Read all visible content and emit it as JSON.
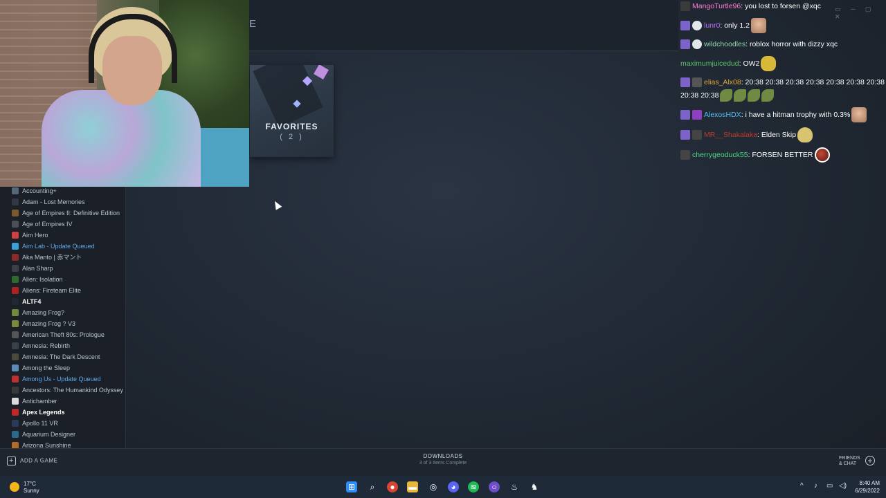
{
  "top_strip": {
    "partial_text": "E"
  },
  "favorites": {
    "title": "FAVORITES",
    "count": "( 2 )"
  },
  "sidebar": {
    "games": [
      {
        "name": "Accounting+",
        "status": "",
        "color": "#556677",
        "style": "normal"
      },
      {
        "name": "Adam - Lost Memories",
        "status": "",
        "color": "#333842",
        "style": "normal"
      },
      {
        "name": "Age of Empires II: Definitive Edition",
        "status": "",
        "color": "#7a5a2a",
        "style": "normal"
      },
      {
        "name": "Age of Empires IV",
        "status": "",
        "color": "#4a4f58",
        "style": "normal"
      },
      {
        "name": "Aim Hero",
        "status": "",
        "color": "#d04040",
        "style": "normal"
      },
      {
        "name": "Aim Lab",
        "status": " - Update Queued",
        "color": "#3aa0d8",
        "style": "queued"
      },
      {
        "name": "Aka Manto | 赤マント",
        "status": "",
        "color": "#8a2a2a",
        "style": "normal"
      },
      {
        "name": "Alan Sharp",
        "status": "",
        "color": "#3a3f48",
        "style": "normal"
      },
      {
        "name": "Alien: Isolation",
        "status": "",
        "color": "#2f6a2f",
        "style": "normal"
      },
      {
        "name": "Aliens: Fireteam Elite",
        "status": "",
        "color": "#b02020",
        "style": "normal"
      },
      {
        "name": "ALTF4",
        "status": "",
        "color": "#222831",
        "style": "bold"
      },
      {
        "name": "Amazing Frog?",
        "status": "",
        "color": "#6e8a3a",
        "style": "normal"
      },
      {
        "name": "Amazing Frog ? V3",
        "status": "",
        "color": "#7a8a3a",
        "style": "normal"
      },
      {
        "name": "American Theft 80s: Prologue",
        "status": "",
        "color": "#555",
        "style": "normal"
      },
      {
        "name": "Amnesia: Rebirth",
        "status": "",
        "color": "#3a4048",
        "style": "normal"
      },
      {
        "name": "Amnesia: The Dark Descent",
        "status": "",
        "color": "#4a4a3a",
        "style": "normal"
      },
      {
        "name": "Among the Sleep",
        "status": "",
        "color": "#5a8ab8",
        "style": "normal"
      },
      {
        "name": "Among Us",
        "status": " - Update Queued",
        "color": "#c03030",
        "style": "queued"
      },
      {
        "name": "Ancestors: The Humankind Odyssey",
        "status": "",
        "color": "#3a3a3a",
        "style": "normal"
      },
      {
        "name": "Antichamber",
        "status": "",
        "color": "#dcdcdc",
        "style": "normal"
      },
      {
        "name": "Apex Legends",
        "status": "",
        "color": "#c02828",
        "style": "bold"
      },
      {
        "name": "Apollo 11 VR",
        "status": "",
        "color": "#2a3a5a",
        "style": "normal"
      },
      {
        "name": "Aquarium Designer",
        "status": "",
        "color": "#2a6a8a",
        "style": "normal"
      },
      {
        "name": "Arizona Sunshine",
        "status": "",
        "color": "#b06a2a",
        "style": "normal"
      }
    ]
  },
  "bottom_bar": {
    "add_game": "ADD A GAME",
    "downloads_title": "DOWNLOADS",
    "downloads_status": "3 of 3 Items Complete",
    "friends_line1": "FRIENDS",
    "friends_line2": "& CHAT"
  },
  "taskbar": {
    "weather_temp": "17°C",
    "weather_cond": "Sunny",
    "time": "8:40 AM",
    "date": "6/29/2022"
  },
  "chat": {
    "messages": [
      {
        "user": "MangoTurtle96",
        "color": "#ff7fd0",
        "badges": [
          "mod"
        ],
        "text": "you lost to forsen @xqc",
        "emotes": []
      },
      {
        "user": "lunr0",
        "color": "#b36cff",
        "badges": [
          "sub",
          "prime"
        ],
        "text": "only 1.2",
        "emotes": [
          "face"
        ]
      },
      {
        "user": "wildchoodles",
        "color": "#8fd9a8",
        "badges": [
          "sub",
          "prime"
        ],
        "text": "roblox horror with dizzy xqc",
        "emotes": []
      },
      {
        "user": "maximumjuicedud",
        "color": "#59c46a",
        "badges": [],
        "text": "OW2",
        "emotes": [
          "gold"
        ]
      },
      {
        "user": "elias_Alx08",
        "color": "#e0a83a",
        "badges": [
          "sub",
          "sound"
        ],
        "text": "20:38 20:38 20:38 20:38 20:38 20:38 20:38 20:38 20:38",
        "emotes": [
          "leaf",
          "leaf",
          "leaf",
          "leaf"
        ]
      },
      {
        "user": "AlexosHDX",
        "color": "#4fc3f7",
        "badges": [
          "sub",
          "vid"
        ],
        "text": "i have a hitman trophy with 0.3%",
        "emotes": [
          "face"
        ]
      },
      {
        "user": "MR__Shakalaka",
        "color": "#c0392b",
        "badges": [
          "sub",
          "slash"
        ],
        "text": "Elden Skip",
        "emotes": [
          "duck"
        ]
      },
      {
        "user": "cherrygeoduck55",
        "color": "#4cd98a",
        "badges": [
          "slash"
        ],
        "text": "FORSEN BETTER",
        "emotes": [
          "ball"
        ]
      }
    ]
  }
}
